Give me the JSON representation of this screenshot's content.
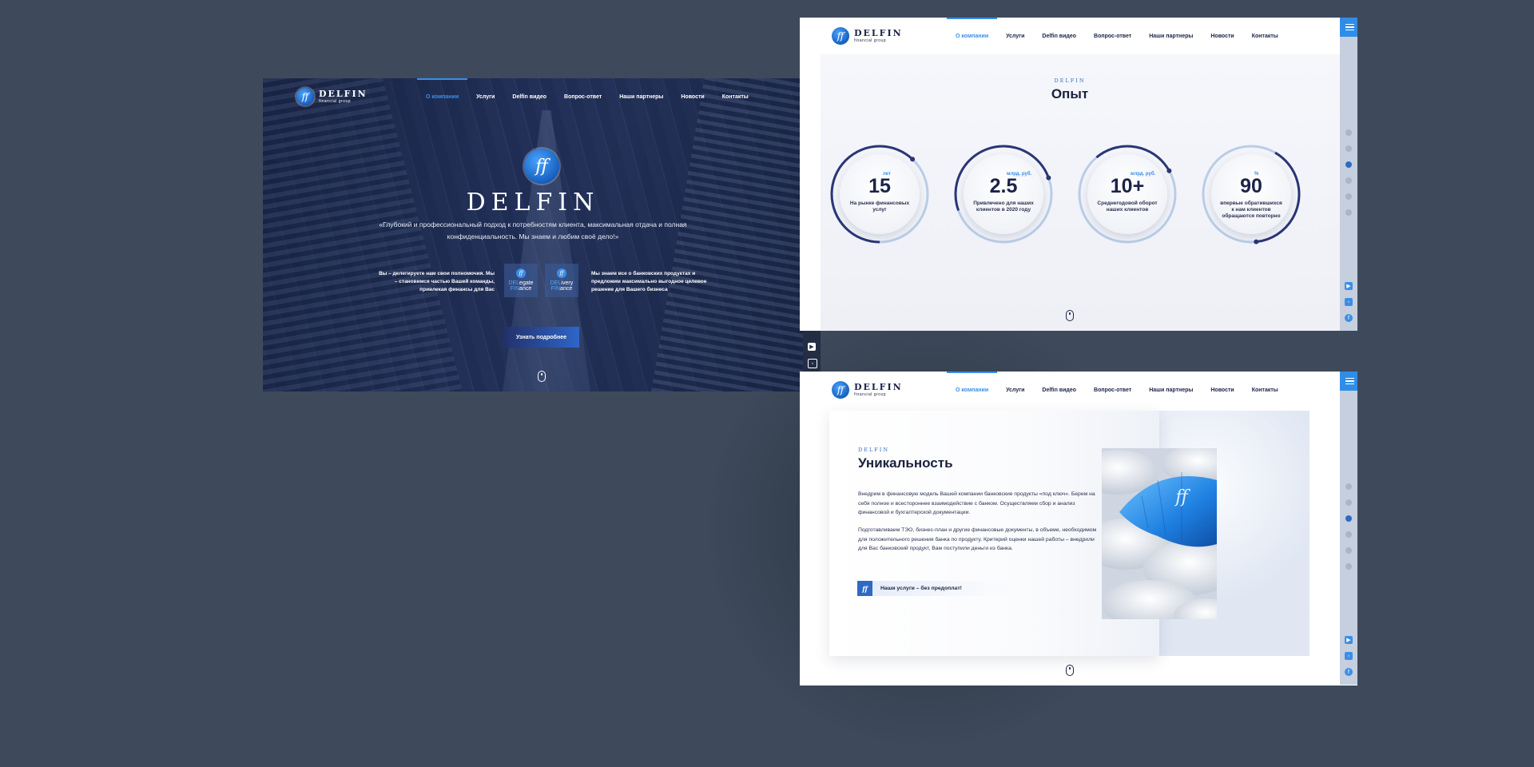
{
  "brand": {
    "name": "DELFIN",
    "sub": "financial group",
    "mark": "ff"
  },
  "menu": [
    "О компании",
    "Услуги",
    "Delfin видео",
    "Вопрос-ответ",
    "Наши партнеры",
    "Новости",
    "Контакты"
  ],
  "hero": {
    "title": "DELFIN",
    "quote": "«Глубокий и профессиональный подход к потребностям клиента, максимальная отдача и полная конфиденциальность. Мы знаем и любим своё дело!»",
    "left_text": "Вы – делегируете нам свои полномочия. Мы – становимся частью Вашей команды, привлекая финансы для Вас",
    "right_text": "Мы знаем все о банковских продуктах и предложим максимально выгодное целевое решение для Вашего бизнеса",
    "card1": {
      "hl1": "DEL",
      "rest1": "egate",
      "hl2": "FIN",
      "rest2": "ance"
    },
    "card2": {
      "hl1": "DEL",
      "rest1": "ivery",
      "hl2": "FIN",
      "rest2": "ance"
    },
    "button": "Узнать подробнее"
  },
  "experience": {
    "kicker": "DELFIN",
    "title": "Опыт",
    "stats": [
      {
        "num": "15",
        "unit": "лет",
        "caption": "На рынке финансовых услуг",
        "progress": 0.62
      },
      {
        "num": "2.5",
        "unit": "млрд. руб.",
        "caption": "Привлечено для наших клиентов в 2020 году",
        "progress": 0.5
      },
      {
        "num": "10+",
        "unit": "млрд. руб.",
        "caption": "Среднегодовой оборот наших клиентов",
        "progress": 0.28
      },
      {
        "num": "90",
        "unit": "%",
        "caption": "впервые обратившихся к нам клиентов обращаются повторно",
        "progress": 0.4
      }
    ]
  },
  "uniqueness": {
    "kicker": "DELFIN",
    "title": "Уникальность",
    "para1": "Внедрим в финансовую модель Вашей компании банковские продукты «под ключ». Берем на себя полное и всестороннее взаимодействие с банком. Осуществляем сбор и анализ финансовой и бухгалтерской документации.",
    "para2": "Подготавливаем ТЭО, бизнес-план и другие финансовые документы, в объеме, необходимом для положительного решения банка по продукту. Критерий оценки нашей работы – внедрили для Вас банковский продукт, Вам поступили деньги из банка.",
    "cta": "Наши услуги – без предоплат!"
  },
  "colors": {
    "accent": "#3b8ee8",
    "navy": "#1b2348",
    "bg": "#3e4a5b"
  },
  "icons": [
    "burger-menu-icon",
    "scroll-mouse-icon",
    "youtube-icon",
    "instagram-icon",
    "facebook-icon",
    "logo-mark-icon"
  ]
}
